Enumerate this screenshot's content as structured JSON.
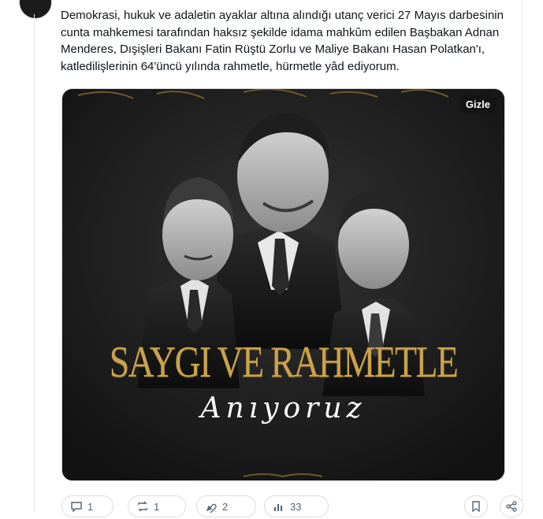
{
  "post": {
    "text": "Demokrasi, hukuk ve adaletin ayaklar altına alındığı utanç verici 27 Mayıs darbesinin cunta mahkemesi tarafından haksız şekilde idama mahkûm edilen Başbakan Adnan Menderes, Dışişleri Bakanı Fatin Rüştü Zorlu ve Maliye Bakanı Hasan Polatkan'ı, katledilişlerinin 64'üncü yılında rahmetle, hürmetle yâd ediyorum."
  },
  "media": {
    "hide_label": "Gizle",
    "title": "SAYGI VE RAHMETLE",
    "subtitle": "Anıyoruz",
    "accent_color": "#c9a24a",
    "background_color": "#1c1c1c"
  },
  "actions": {
    "reply": {
      "count": "1",
      "icon": "reply-icon"
    },
    "repost": {
      "count": "1",
      "icon": "repost-icon"
    },
    "like": {
      "count": "2",
      "icon": "like-icon"
    },
    "views": {
      "count": "33",
      "icon": "views-icon"
    },
    "bookmark": {
      "icon": "bookmark-icon"
    },
    "share": {
      "icon": "share-icon"
    }
  }
}
